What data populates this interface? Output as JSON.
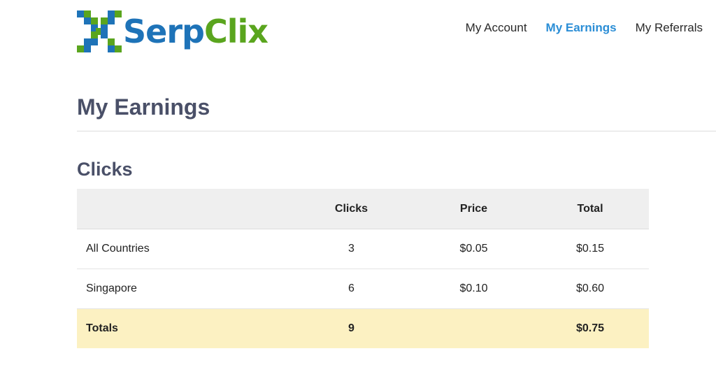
{
  "brand": {
    "name_part1": "Serp",
    "name_part2": "Clix",
    "color_primary": "#1e73b8",
    "color_secondary": "#5aa51e"
  },
  "nav": {
    "items": [
      {
        "label": "My Account",
        "active": false
      },
      {
        "label": "My Earnings",
        "active": true
      },
      {
        "label": "My Referrals",
        "active": false
      }
    ],
    "active_color": "#2b8ed6"
  },
  "page": {
    "title": "My Earnings"
  },
  "clicks_section": {
    "title": "Clicks",
    "columns": [
      "",
      "Clicks",
      "Price",
      "Total"
    ],
    "rows": [
      {
        "label": "All Countries",
        "clicks": "3",
        "price": "$0.05",
        "total": "$0.15"
      },
      {
        "label": "Singapore",
        "clicks": "6",
        "price": "$0.10",
        "total": "$0.60"
      }
    ],
    "totals": {
      "label": "Totals",
      "clicks": "9",
      "price": "",
      "total": "$0.75"
    },
    "totals_row_color": "#fcf1c2"
  }
}
